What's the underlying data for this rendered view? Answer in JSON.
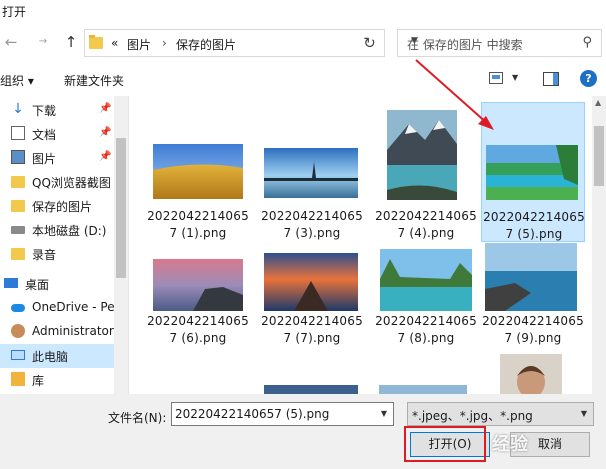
{
  "window": {
    "title": "打开"
  },
  "nav": {
    "back_icon": "arrow-left-icon",
    "forward_icon": "arrow-right-icon",
    "up_icon": "arrow-up-icon",
    "address": {
      "prefix": "«",
      "crumbs": [
        "图片",
        "保存的图片"
      ]
    },
    "search_placeholder": "在 保存的图片 中搜索"
  },
  "toolbar": {
    "organize": "组织 ▾",
    "new_folder": "新建文件夹"
  },
  "sidebar": {
    "items": [
      {
        "label": "下载",
        "icon": "download-icon",
        "pinned": true
      },
      {
        "label": "文档",
        "icon": "document-icon",
        "pinned": true
      },
      {
        "label": "图片",
        "icon": "pictures-icon",
        "pinned": true
      },
      {
        "label": "QQ浏览器截图",
        "icon": "folder-icon",
        "pinned": false
      },
      {
        "label": "保存的图片",
        "icon": "folder-icon",
        "pinned": false
      },
      {
        "label": "本地磁盘 (D:)",
        "icon": "drive-icon",
        "pinned": false
      },
      {
        "label": "录音",
        "icon": "folder-icon",
        "pinned": false
      },
      {
        "label": "桌面",
        "icon": "desktop-icon",
        "pinned": false
      },
      {
        "label": "OneDrive - Pe",
        "icon": "cloud-icon",
        "pinned": false
      },
      {
        "label": "Administrator",
        "icon": "user-icon",
        "pinned": false
      },
      {
        "label": "此电脑",
        "icon": "computer-icon",
        "pinned": false,
        "selected": true
      },
      {
        "label": "库",
        "icon": "library-icon",
        "pinned": false
      }
    ]
  },
  "files": [
    {
      "name": "20220422140657 (1).png",
      "line1": "2022042214065",
      "line2": "7 (1).png",
      "selected": false
    },
    {
      "name": "20220422140657 (3).png",
      "line1": "2022042214065",
      "line2": "7 (3).png",
      "selected": false
    },
    {
      "name": "20220422140657 (4).png",
      "line1": "2022042214065",
      "line2": "7 (4).png",
      "selected": false
    },
    {
      "name": "20220422140657 (5).png",
      "line1": "2022042214065",
      "line2": "7 (5).png",
      "selected": true
    },
    {
      "name": "20220422140657 (6).png",
      "line1": "2022042214065",
      "line2": "7 (6).png",
      "selected": false
    },
    {
      "name": "20220422140657 (7).png",
      "line1": "2022042214065",
      "line2": "7 (7).png",
      "selected": false
    },
    {
      "name": "20220422140657 (8).png",
      "line1": "2022042214065",
      "line2": "7 (8).png",
      "selected": false
    },
    {
      "name": "20220422140657 (9).png",
      "line1": "2022042214065",
      "line2": "7 (9).png",
      "selected": false
    }
  ],
  "bottom": {
    "filename_label": "文件名(N):",
    "filename_value": "20220422140657 (5).png",
    "filetype_value": "*.jpeg、*.jpg、*.png",
    "open_label": "打开(O)",
    "cancel_label": "取消"
  },
  "watermark": "经验"
}
